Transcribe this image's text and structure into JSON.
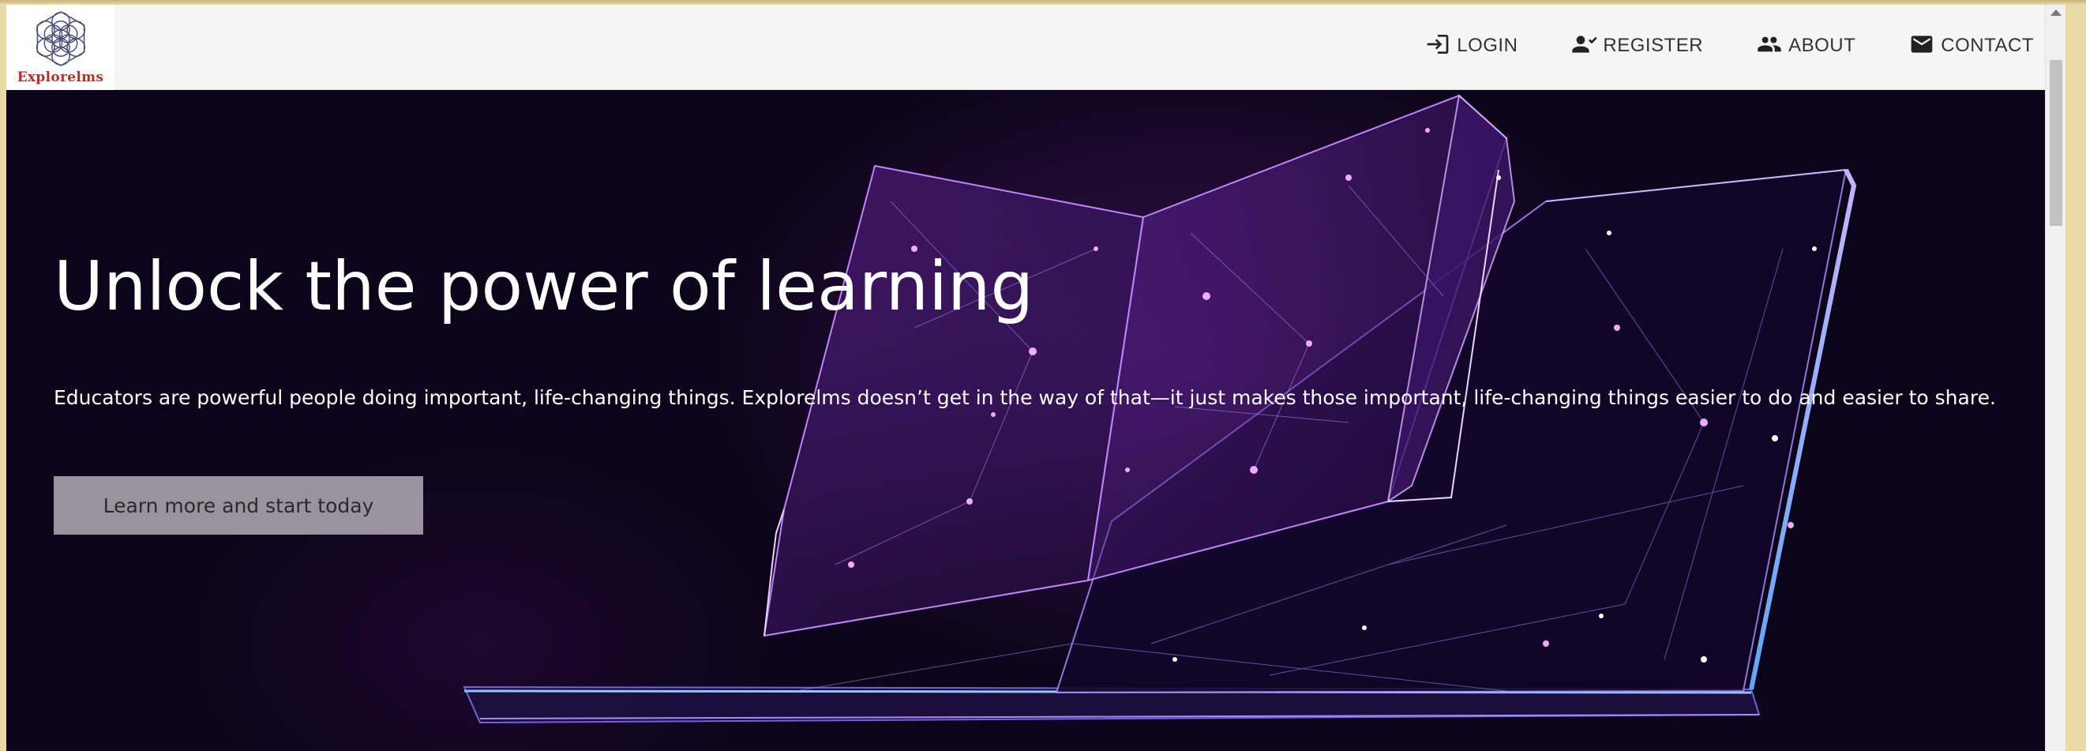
{
  "brand": {
    "name": "Explorelms"
  },
  "nav": {
    "items": [
      {
        "label": "LOGIN",
        "icon": "login-icon"
      },
      {
        "label": "REGISTER",
        "icon": "register-icon"
      },
      {
        "label": "ABOUT",
        "icon": "about-icon"
      },
      {
        "label": "CONTACT",
        "icon": "contact-icon"
      }
    ]
  },
  "hero": {
    "title": "Unlock the power of learning",
    "description": "Educators are powerful people doing important, life-changing things. Explorelms doesn’t get in the way of that—it just makes those important, life-changing things easier to do and easier to share.",
    "cta_label": "Learn more and start today"
  },
  "colors": {
    "hero_background": "#0c0418",
    "accent_purple": "#a855f7",
    "logo_text": "#b1322a",
    "cta_background": "#9a929f"
  }
}
